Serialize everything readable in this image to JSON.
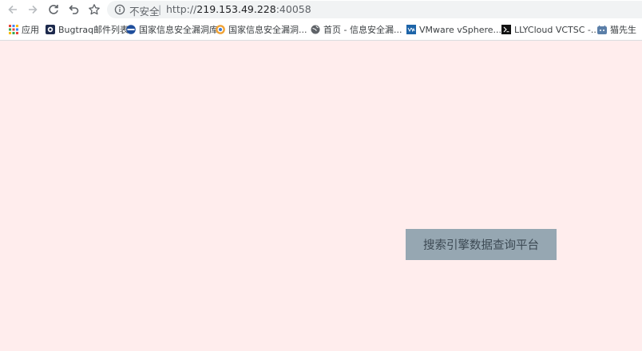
{
  "browser": {
    "security_label": "不安全",
    "separator": "|",
    "url": {
      "scheme": "http://",
      "host": "219.153.49.228",
      "port": ":40058"
    }
  },
  "bookmarks": [
    {
      "label": "应用",
      "icon": "apps-grid-icon"
    },
    {
      "label": "Bugtraq邮件列表",
      "icon": "bugtraq-favicon"
    },
    {
      "label": "国家信息安全漏洞库",
      "icon": "cnnvd-favicon"
    },
    {
      "label": "国家信息安全漏洞...",
      "icon": "cnnvd-favicon"
    },
    {
      "label": "首页 - 信息安全漏...",
      "icon": "globe-icon"
    },
    {
      "label": "VMware vSphere...",
      "icon": "vmware-favicon"
    },
    {
      "label": "LLYCloud VCTSC -...",
      "icon": "llycloud-favicon"
    },
    {
      "label": "猫先生",
      "icon": "cat-favicon"
    }
  ],
  "page": {
    "button_label": "搜索引擎数据查询平台"
  },
  "colors": {
    "page_background": "#ffeded",
    "button_background": "#96a7b2",
    "button_text": "#3d4a54"
  }
}
